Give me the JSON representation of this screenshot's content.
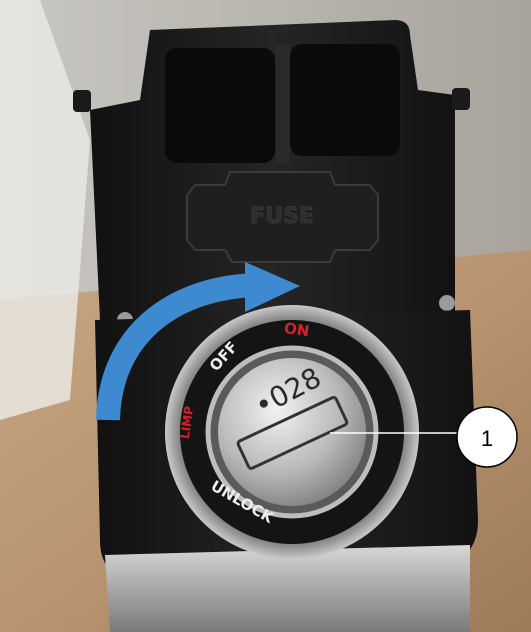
{
  "photo": {
    "fuse_label": "FUSE",
    "position_off": "OFF",
    "position_on": "ON",
    "position_limp": "LIMP",
    "position_unlock": "UNLOCK",
    "key_code": "•028",
    "arrow_color": "#3e8ad0",
    "label_red": "#d4202a",
    "housing_color": "#1a1a1a"
  },
  "callout": {
    "number": "1"
  }
}
